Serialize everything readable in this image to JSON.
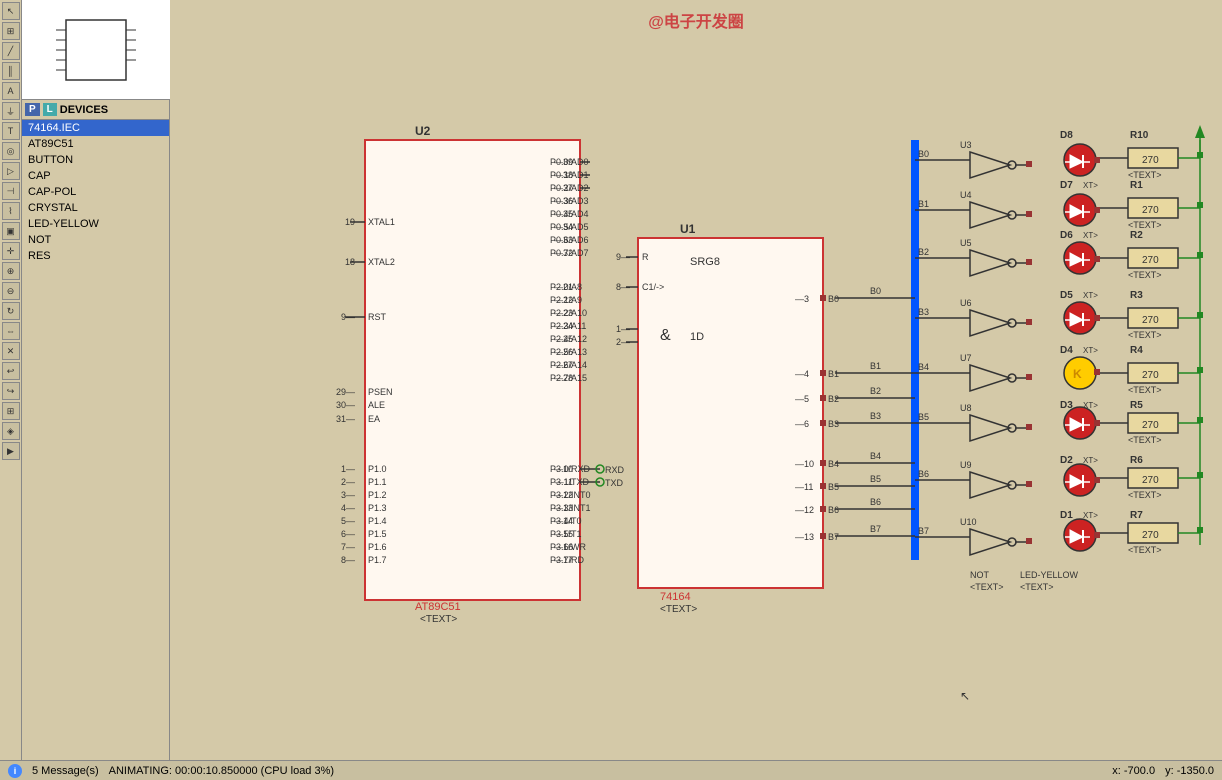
{
  "toolbar": {
    "tools": [
      "arrow",
      "component",
      "wire",
      "bus",
      "label",
      "power",
      "text",
      "probe",
      "terminal",
      "pin",
      "graph",
      "tape",
      "cursor",
      "zoom-in",
      "zoom-out",
      "rotate",
      "mirror",
      "delete",
      "undo",
      "redo",
      "grid",
      "snap",
      "run"
    ]
  },
  "component_panel": {
    "p_label": "P",
    "l_label": "L",
    "devices_label": "DEVICES",
    "device_list": [
      "74164.IEC",
      "AT89C51",
      "BUTTON",
      "CAP",
      "CAP-POL",
      "CRYSTAL",
      "LED-YELLOW",
      "NOT",
      "RES"
    ]
  },
  "watermark": "@电子开发圈",
  "status": {
    "messages": "5 Message(s)",
    "animating": "ANIMATING: 00:00:10.850000 (CPU load 3%)",
    "x_coord": "x:   -700.0",
    "y_coord": "y:    -1350.0"
  },
  "schematic": {
    "u2_label": "U2",
    "u2_part": "AT89C51",
    "u2_text": "<TEXT>",
    "u1_label": "U1",
    "u1_part": "74164",
    "u1_text": "<TEXT>",
    "srg8_label": "SRG8",
    "not_label": "NOT",
    "not_text": "<TEXT>",
    "led_yellow_label": "LED-YELLOW",
    "led_text": "<TEXT>"
  }
}
